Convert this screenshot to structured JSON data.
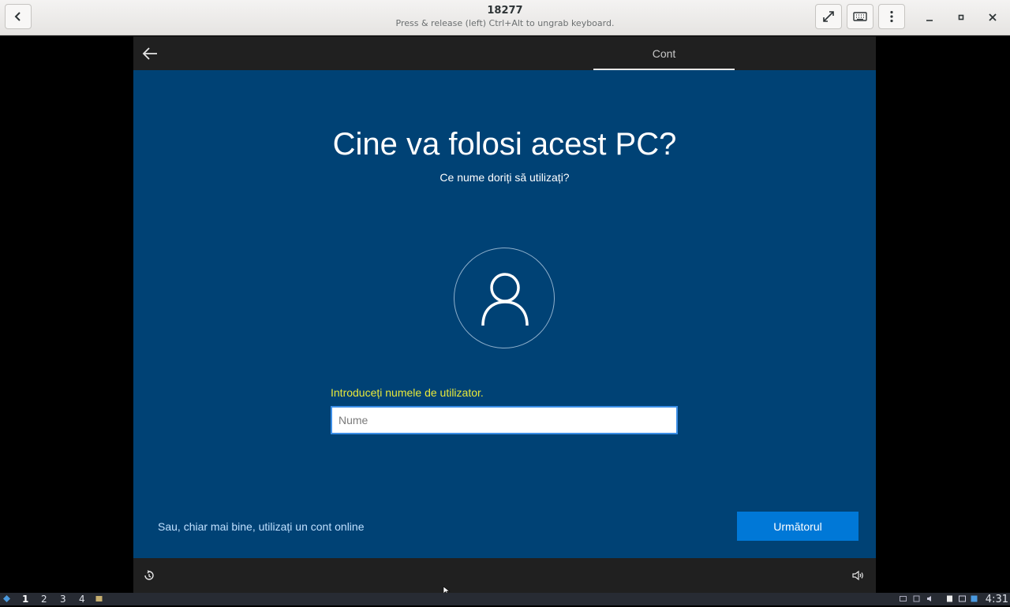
{
  "viewer": {
    "title": "18277",
    "subtitle": "Press & release (left) Ctrl+Alt to ungrab keyboard."
  },
  "oobe": {
    "tab_label": "Cont",
    "title": "Cine va folosi acest PC?",
    "subtitle": "Ce nume doriți să utilizați?",
    "prompt": "Introduceți numele de utilizator.",
    "input_placeholder": "Nume",
    "input_value": "",
    "online_link": "Sau, chiar mai bine, utilizați un cont online",
    "next_button": "Următorul"
  },
  "taskbar": {
    "workspaces": [
      "1",
      "2",
      "3",
      "4"
    ],
    "active_workspace": "1",
    "clock": "4:31"
  },
  "colors": {
    "oobe_background": "#004275",
    "accent": "#0078d7",
    "prompt_text": "#e8e83a",
    "link_text": "#bfe0ff"
  },
  "icons": [
    "back-icon",
    "fullscreen-icon",
    "keyboard-icon",
    "menu-icon",
    "minimize-icon",
    "maximize-icon",
    "close-icon",
    "user-avatar-icon",
    "accessibility-icon",
    "volume-icon"
  ]
}
